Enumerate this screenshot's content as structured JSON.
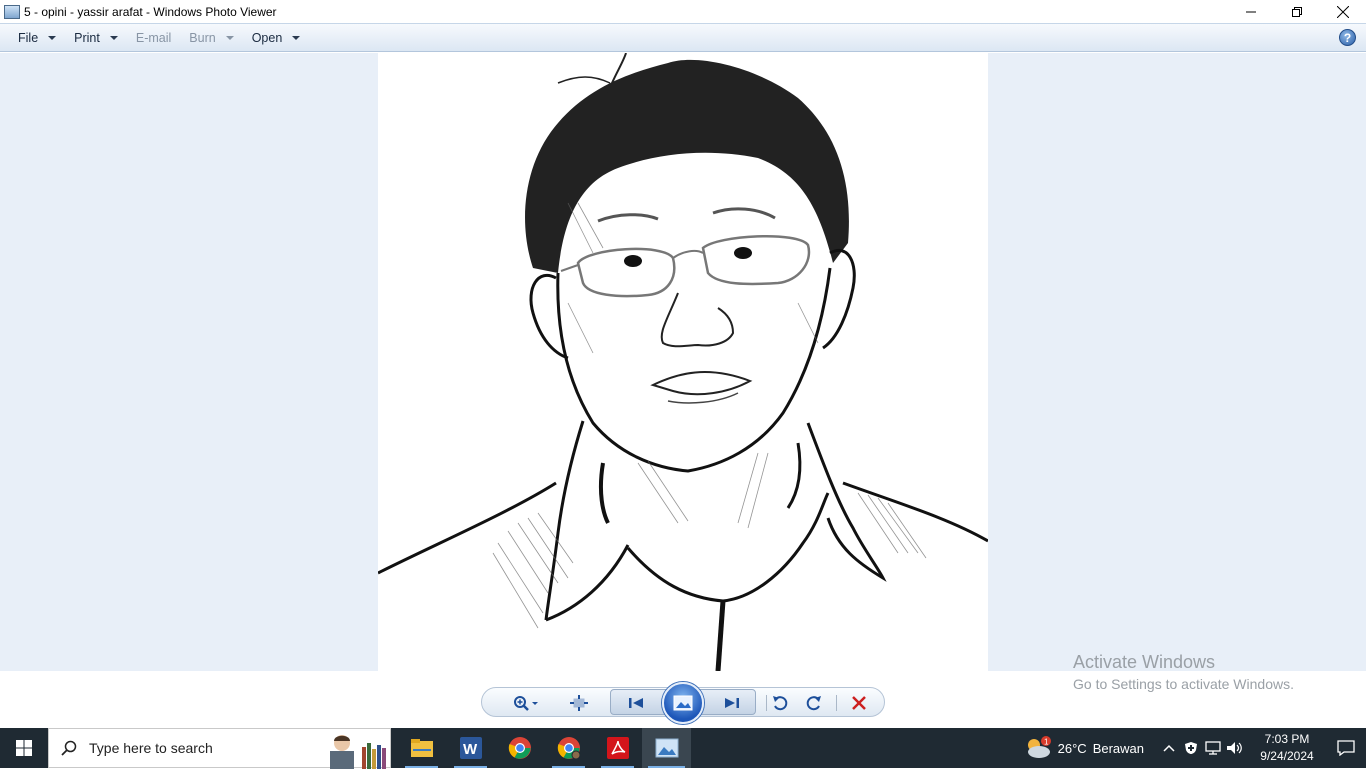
{
  "window": {
    "title": "5 - opini - yassir arafat - Windows Photo Viewer"
  },
  "menu": {
    "items": [
      {
        "label": "File",
        "enabled": true
      },
      {
        "label": "Print",
        "enabled": true
      },
      {
        "label": "E-mail",
        "enabled": false
      },
      {
        "label": "Burn",
        "enabled": false
      },
      {
        "label": "Open",
        "enabled": true
      }
    ],
    "help_label": "?"
  },
  "watermark": {
    "title": "Activate Windows",
    "subtitle": "Go to Settings to activate Windows."
  },
  "taskbar": {
    "search_placeholder": "Type here to search",
    "weather_temp": "26°C",
    "weather_condition": "Berawan",
    "weather_badge": "1",
    "time": "7:03 PM",
    "date": "9/24/2024"
  },
  "colors": {
    "viewer_bg": "#e8eff8",
    "taskbar_bg": "#1f2a33",
    "delete_red": "#cc1f1f",
    "accent_blue": "#1d56b8"
  }
}
